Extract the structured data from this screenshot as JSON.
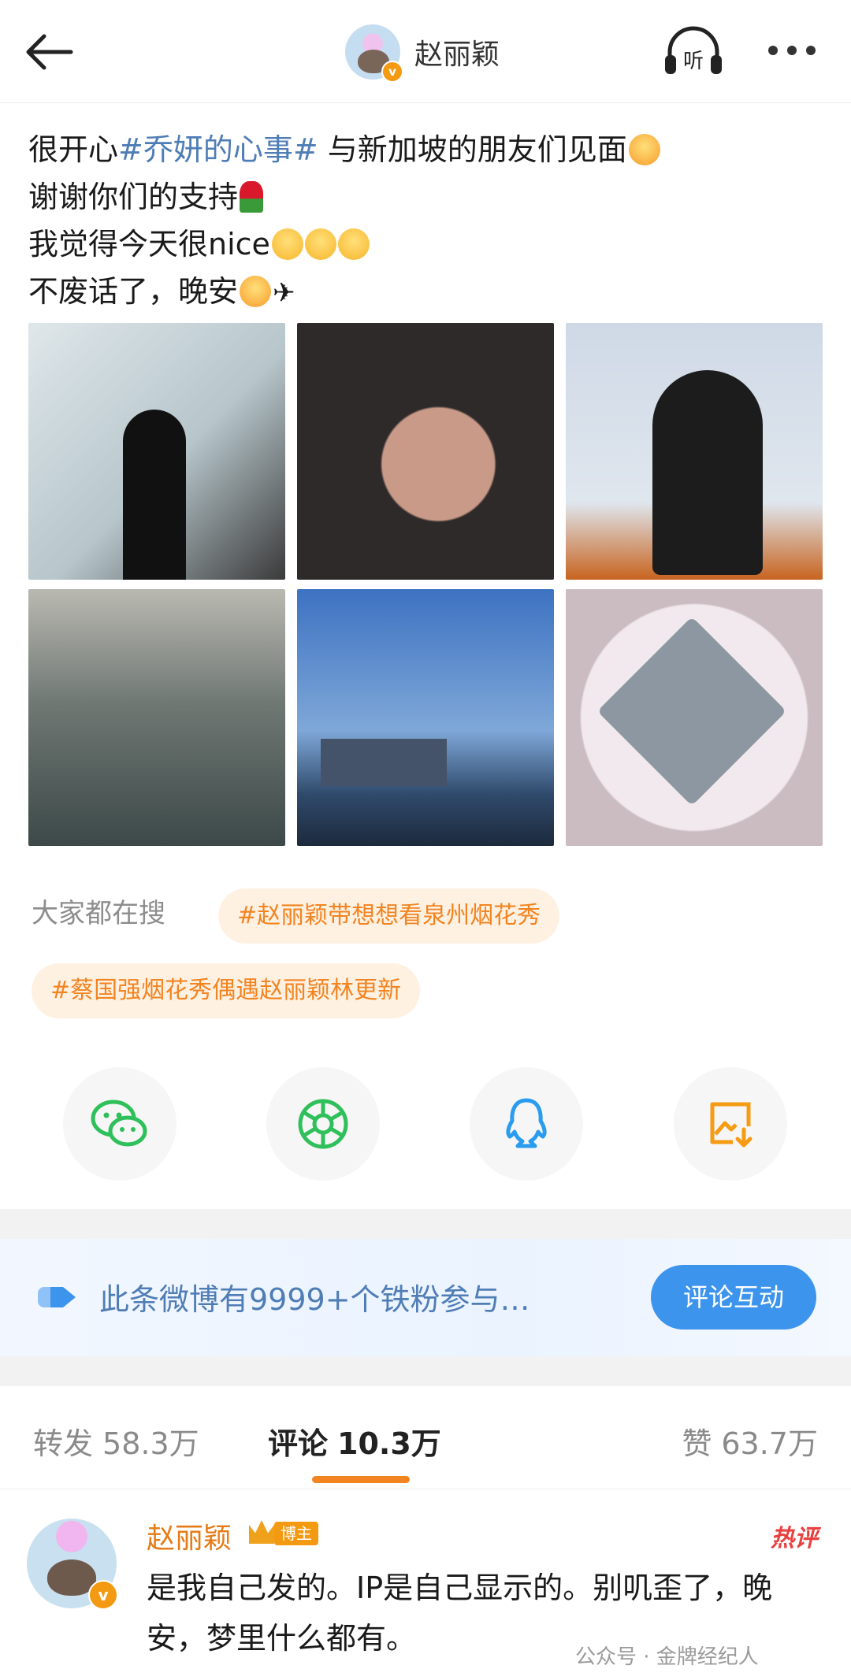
{
  "header": {
    "title": "赵丽颖",
    "back_icon": "back-arrow-icon",
    "listen_label": "听",
    "more_icon": "more-dots-icon",
    "verified_badge": "v"
  },
  "post": {
    "line1_pre": "很开心",
    "line1_topic": "#乔妍的心事#",
    "line1_post": " 与新加坡的朋友们见面",
    "line2": "谢谢你们的支持",
    "line3": "我觉得今天很nice",
    "line4": "不废话了，晚安"
  },
  "search": {
    "label": "大家都在搜",
    "chip1": "#赵丽颖带想想看泉州烟花秀",
    "chip2": "#蔡国强烟花秀偶遇赵丽颖林更新"
  },
  "share": [
    "wechat-icon",
    "moments-icon",
    "qq-icon",
    "save-image-icon"
  ],
  "fans": {
    "text": "此条微博有9999+个铁粉参与…",
    "button": "评论互动"
  },
  "tabs": {
    "repost_label": "转发",
    "repost_count": "58.3万",
    "comment_label": "评论",
    "comment_count": "10.3万",
    "like_label": "赞",
    "like_count": "63.7万"
  },
  "comment": {
    "user": "赵丽颖",
    "badge": "博主",
    "hot": "热评",
    "text": "是我自己发的。IP是自己显示的。别叽歪了，晚安，梦里什么都有。"
  },
  "watermark": "公众号 · 金牌经纪人",
  "colors": {
    "accent": "#f28421",
    "link": "#4f7db5",
    "button": "#3d94ec"
  }
}
